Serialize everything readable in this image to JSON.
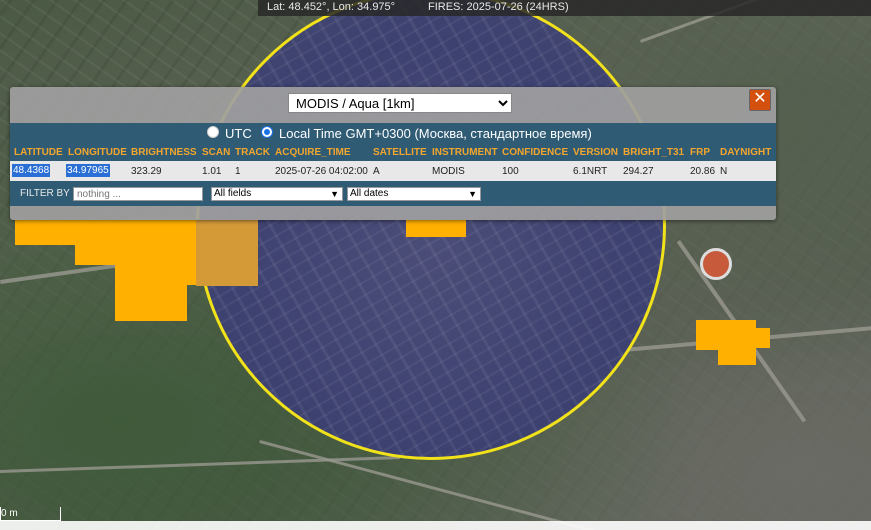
{
  "status": {
    "coords": "Lat: 48.452°, Lon: 34.975°",
    "fires": "FIRES: 2025-07-26 (24HRS)"
  },
  "popup": {
    "satellite_selected": "MODIS / Aqua [1km]",
    "close_label": "✕",
    "timezone": {
      "utc_label": "UTC",
      "local_label": "Local Time GMT+0300 (Москва, стандартное время)",
      "selected": "local"
    },
    "table": {
      "headers": [
        "LATITUDE",
        "LONGITUDE",
        "BRIGHTNESS",
        "SCAN",
        "TRACK",
        "ACQUIRE_TIME",
        "SATELLITE",
        "INSTRUMENT",
        "CONFIDENCE",
        "VERSION",
        "BRIGHT_T31",
        "FRP",
        "DAYNIGHT"
      ],
      "row": [
        "48.4368",
        "34.97965",
        "323.29",
        "1.01",
        "1",
        "2025-07-26 04:02:00",
        "A",
        "MODIS",
        "100",
        "6.1NRT",
        "294.27",
        "20.86",
        "N"
      ]
    },
    "filter": {
      "label": "FILTER BY",
      "placeholder": "nothing ...",
      "fields_selected": "All fields",
      "dates_selected": "All dates"
    }
  },
  "scale": {
    "label": "0 m"
  },
  "colors": {
    "fire": "#ffb000",
    "circle": "#f2e21a",
    "close": "#d4500f",
    "header_text": "#f2a62e",
    "bar": "#2f5b74"
  }
}
